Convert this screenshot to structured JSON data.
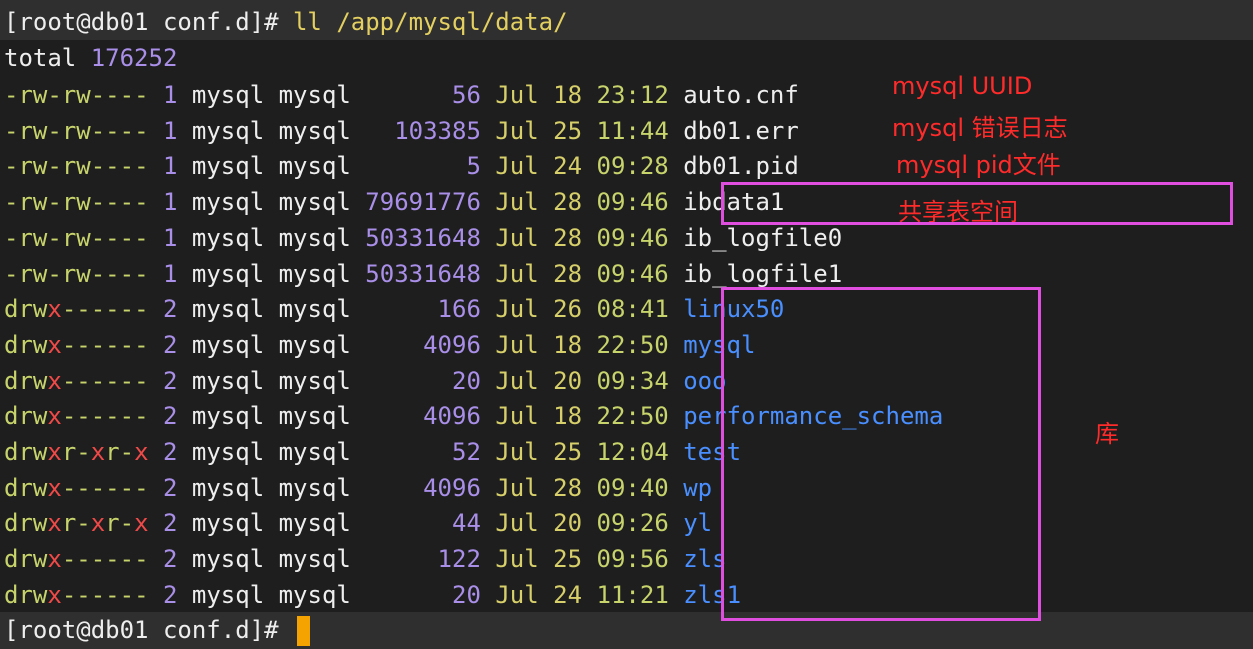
{
  "terminal": {
    "prompt": "[root@db01 conf.d]# ",
    "command": "ll /app/mysql/data/",
    "total_label": "total",
    "total_value": "176252",
    "entries": [
      {
        "perm": "-rw-rw----",
        "links": "1",
        "owner": "mysql",
        "group": "mysql",
        "size": "56",
        "date": "Jul 18",
        "time": "23:12",
        "name": "auto.cnf"
      },
      {
        "perm": "-rw-rw----",
        "links": "1",
        "owner": "mysql",
        "group": "mysql",
        "size": "103385",
        "date": "Jul 25",
        "time": "11:44",
        "name": "db01.err"
      },
      {
        "perm": "-rw-rw----",
        "links": "1",
        "owner": "mysql",
        "group": "mysql",
        "size": "5",
        "date": "Jul 24",
        "time": "09:28",
        "name": "db01.pid"
      },
      {
        "perm": "-rw-rw----",
        "links": "1",
        "owner": "mysql",
        "group": "mysql",
        "size": "79691776",
        "date": "Jul 28",
        "time": "09:46",
        "name": "ibdata1"
      },
      {
        "perm": "-rw-rw----",
        "links": "1",
        "owner": "mysql",
        "group": "mysql",
        "size": "50331648",
        "date": "Jul 28",
        "time": "09:46",
        "name": "ib_logfile0"
      },
      {
        "perm": "-rw-rw----",
        "links": "1",
        "owner": "mysql",
        "group": "mysql",
        "size": "50331648",
        "date": "Jul 28",
        "time": "09:46",
        "name": "ib_logfile1"
      },
      {
        "perm": "drwx------",
        "links": "2",
        "owner": "mysql",
        "group": "mysql",
        "size": "166",
        "date": "Jul 26",
        "time": "08:41",
        "name": "linux50"
      },
      {
        "perm": "drwx------",
        "links": "2",
        "owner": "mysql",
        "group": "mysql",
        "size": "4096",
        "date": "Jul 18",
        "time": "22:50",
        "name": "mysql"
      },
      {
        "perm": "drwx------",
        "links": "2",
        "owner": "mysql",
        "group": "mysql",
        "size": "20",
        "date": "Jul 20",
        "time": "09:34",
        "name": "ooo"
      },
      {
        "perm": "drwx------",
        "links": "2",
        "owner": "mysql",
        "group": "mysql",
        "size": "4096",
        "date": "Jul 18",
        "time": "22:50",
        "name": "performance_schema"
      },
      {
        "perm": "drwxr-xr-x",
        "links": "2",
        "owner": "mysql",
        "group": "mysql",
        "size": "52",
        "date": "Jul 25",
        "time": "12:04",
        "name": "test"
      },
      {
        "perm": "drwx------",
        "links": "2",
        "owner": "mysql",
        "group": "mysql",
        "size": "4096",
        "date": "Jul 28",
        "time": "09:40",
        "name": "wp"
      },
      {
        "perm": "drwxr-xr-x",
        "links": "2",
        "owner": "mysql",
        "group": "mysql",
        "size": "44",
        "date": "Jul 20",
        "time": "09:26",
        "name": "yl"
      },
      {
        "perm": "drwx------",
        "links": "2",
        "owner": "mysql",
        "group": "mysql",
        "size": "122",
        "date": "Jul 25",
        "time": "09:56",
        "name": "zls"
      },
      {
        "perm": "drwx------",
        "links": "2",
        "owner": "mysql",
        "group": "mysql",
        "size": "20",
        "date": "Jul 24",
        "time": "11:21",
        "name": "zls1"
      }
    ]
  },
  "annotations": {
    "uuid": "mysql UUID",
    "error_log": "mysql 错误日志",
    "pid_file": "mysql pid文件",
    "shared_tablespace": "共享表空间",
    "databases": "库"
  },
  "colors": {
    "background": "#1e1e1e",
    "annotation_red": "#ff2b2b",
    "highlight_box": "#e04ee0",
    "cursor": "#f5a300"
  }
}
